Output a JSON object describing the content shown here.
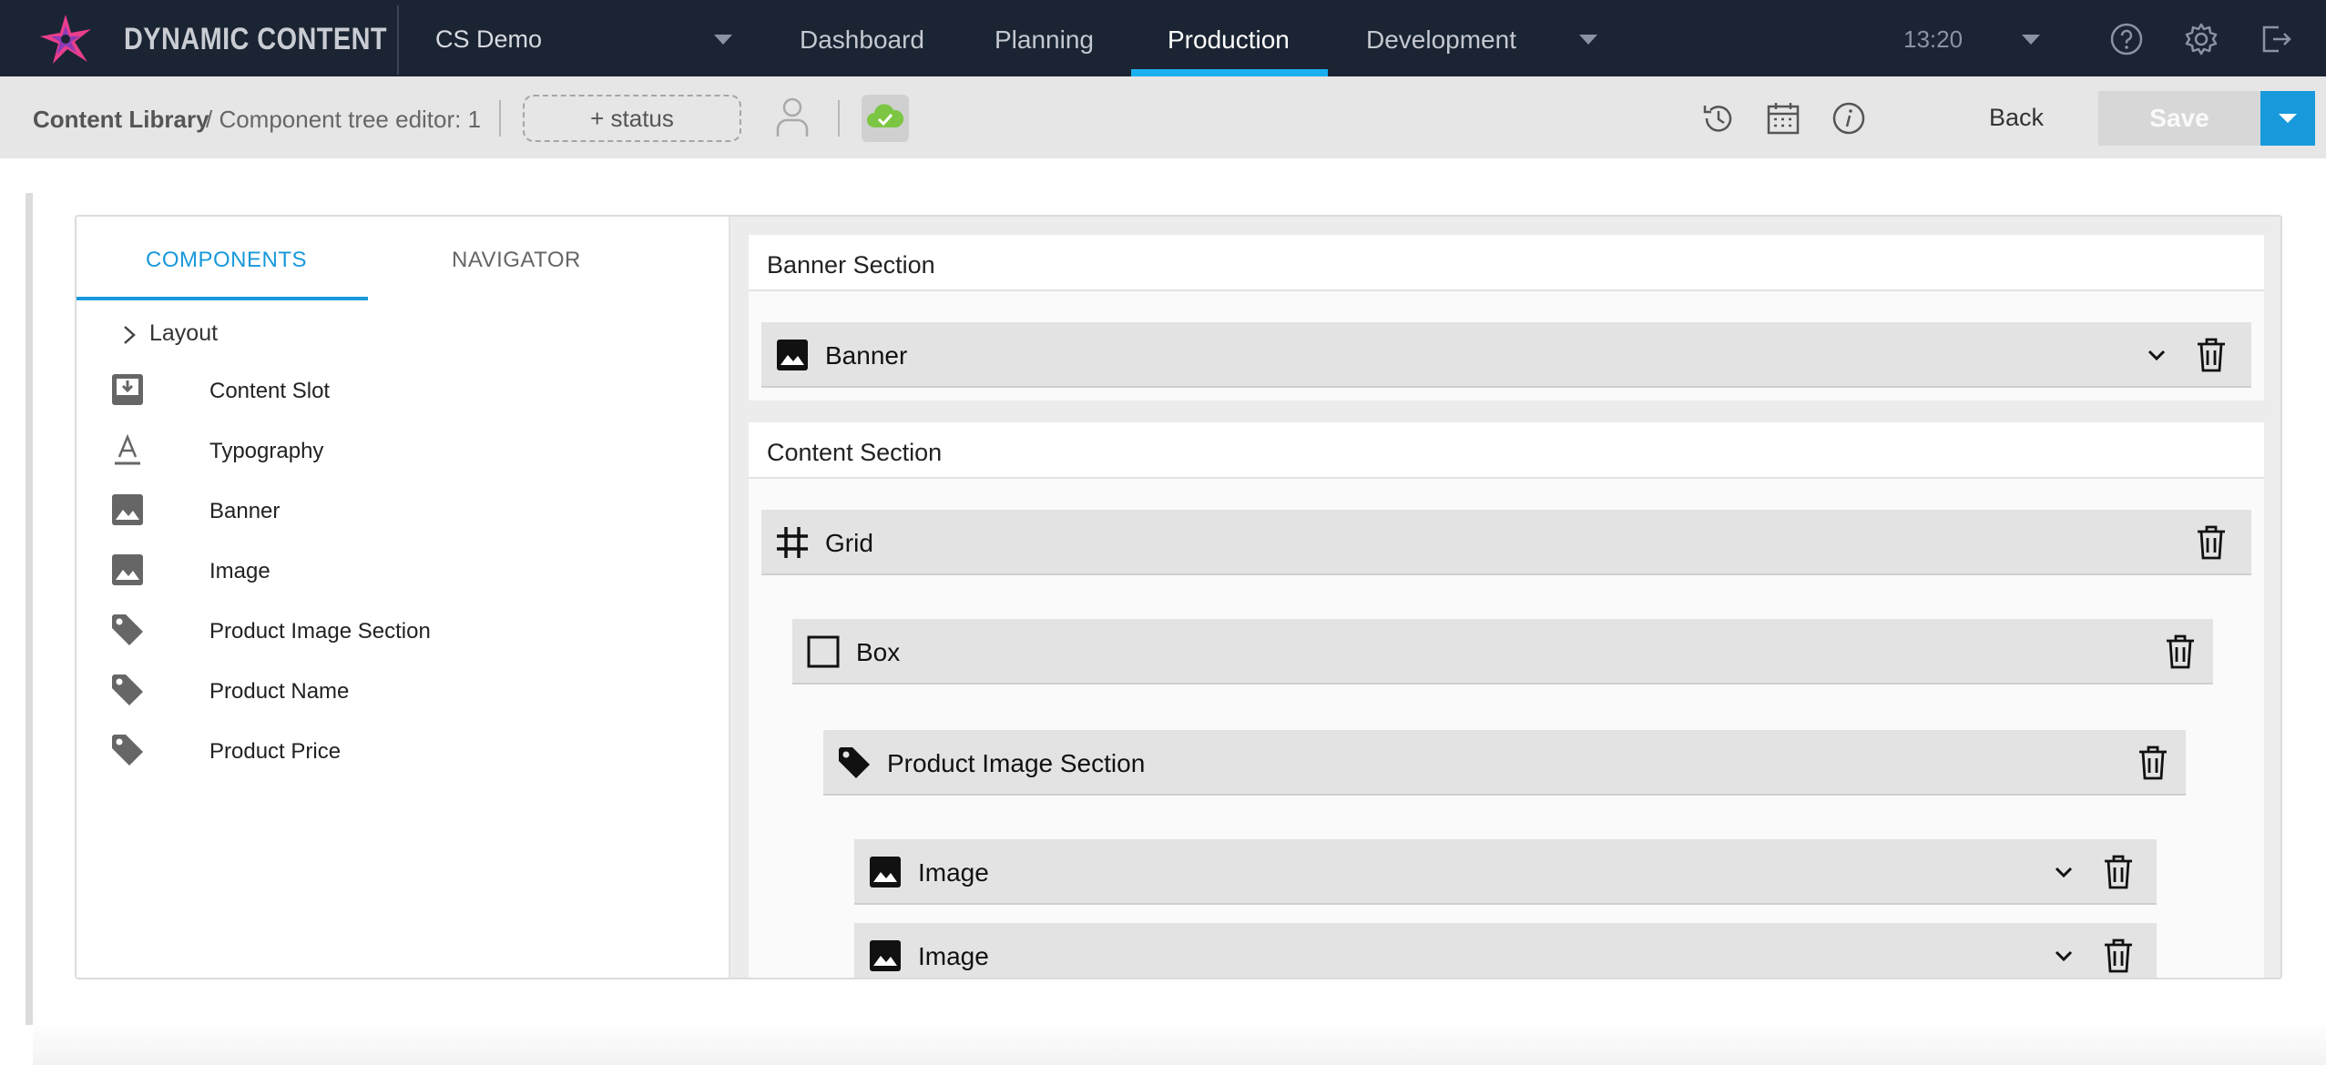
{
  "app": {
    "brand": "DYNAMIC CONTENT",
    "hub": "CS Demo",
    "clock": "13:20"
  },
  "nav": {
    "tabs": [
      {
        "label": "Dashboard",
        "active": false
      },
      {
        "label": "Planning",
        "active": false
      },
      {
        "label": "Production",
        "active": true
      },
      {
        "label": "Development",
        "active": false
      }
    ]
  },
  "toolbar": {
    "breadcrumb_root": "Content Library",
    "breadcrumb_current": "/ Component tree editor: 1",
    "status_label": "+ status",
    "back_label": "Back",
    "save_label": "Save"
  },
  "library": {
    "tabs": [
      "COMPONENTS",
      "NAVIGATOR"
    ],
    "active_tab": "COMPONENTS",
    "group_label": "Layout",
    "items": [
      {
        "label": "Content Slot",
        "icon": "content-slot-icon"
      },
      {
        "label": "Typography",
        "icon": "typography-icon"
      },
      {
        "label": "Banner",
        "icon": "image-icon"
      },
      {
        "label": "Image",
        "icon": "image-icon"
      },
      {
        "label": "Product Image Section",
        "icon": "tag-icon"
      },
      {
        "label": "Product Name",
        "icon": "tag-icon"
      },
      {
        "label": "Product Price",
        "icon": "tag-icon"
      }
    ]
  },
  "tree": {
    "banner_section": {
      "title": "Banner Section",
      "component": "Banner"
    },
    "content_section": {
      "title": "Content Section",
      "grid": "Grid",
      "box": "Box",
      "product_image_section": "Product Image Section",
      "images": [
        "Image",
        "Image"
      ]
    }
  },
  "colors": {
    "nav_bg": "#1b2433",
    "accent": "#1899db",
    "logo_pink": "#e83e8c",
    "cloud_green": "#7cc644"
  }
}
